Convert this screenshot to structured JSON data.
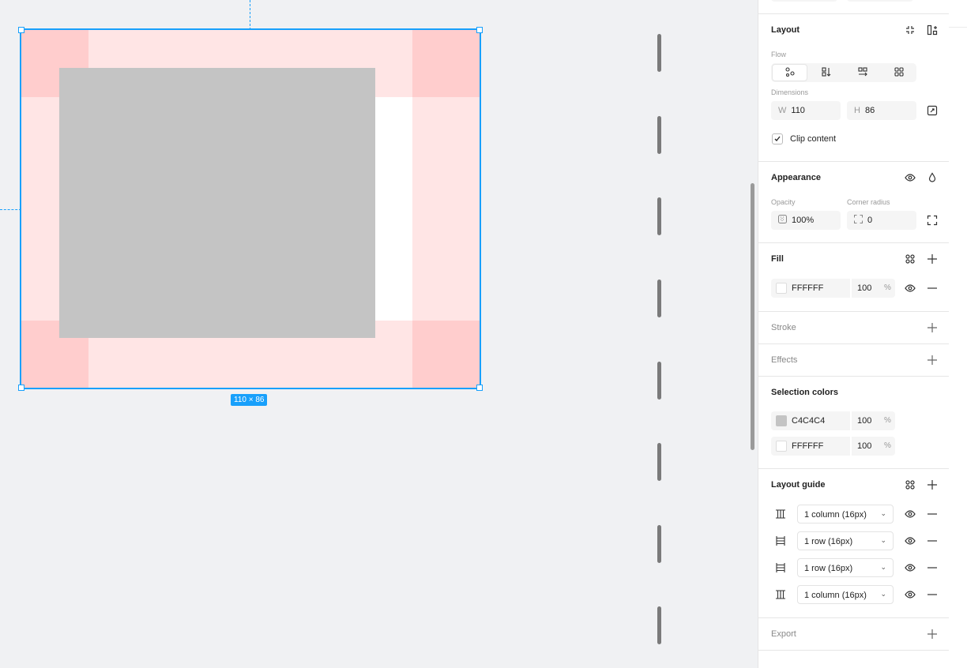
{
  "canvas": {
    "selection_size": "110 × 86"
  },
  "colors": {
    "accent": "#18a0fb",
    "rect_fill": "#c4c4c4",
    "frame_fill": "#ffffff",
    "guide_tint": "rgba(255,0,0,0.1)"
  },
  "layout": {
    "title": "Layout",
    "flow_label": "Flow",
    "dimensions_label": "Dimensions",
    "width_prefix": "W",
    "width_value": "110",
    "height_prefix": "H",
    "height_value": "86",
    "clip_label": "Clip content",
    "clip_checked": true,
    "flow_options": [
      "freeform-icon",
      "vertical-icon",
      "horizontal-wrap-icon",
      "grid-icon"
    ]
  },
  "appearance": {
    "title": "Appearance",
    "opacity_label": "Opacity",
    "opacity_value": "100%",
    "radius_label": "Corner radius",
    "radius_value": "0"
  },
  "fill": {
    "title": "Fill",
    "hex": "FFFFFF",
    "opacity": "100",
    "pct": "%"
  },
  "stroke": {
    "title": "Stroke"
  },
  "effects": {
    "title": "Effects"
  },
  "selection_colors": {
    "title": "Selection colors",
    "items": [
      {
        "hex": "C4C4C4",
        "opacity": "100",
        "pct": "%",
        "color": "#c4c4c4"
      },
      {
        "hex": "FFFFFF",
        "opacity": "100",
        "pct": "%",
        "color": "#ffffff"
      }
    ]
  },
  "layout_guide": {
    "title": "Layout guide",
    "items": [
      {
        "label": "1 column (16px)",
        "icon": "columns-icon"
      },
      {
        "label": "1 row (16px)",
        "icon": "rows-icon"
      },
      {
        "label": "1 row (16px)",
        "icon": "rows-icon"
      },
      {
        "label": "1 column (16px)",
        "icon": "columns-icon"
      }
    ]
  },
  "export": {
    "title": "Export"
  }
}
